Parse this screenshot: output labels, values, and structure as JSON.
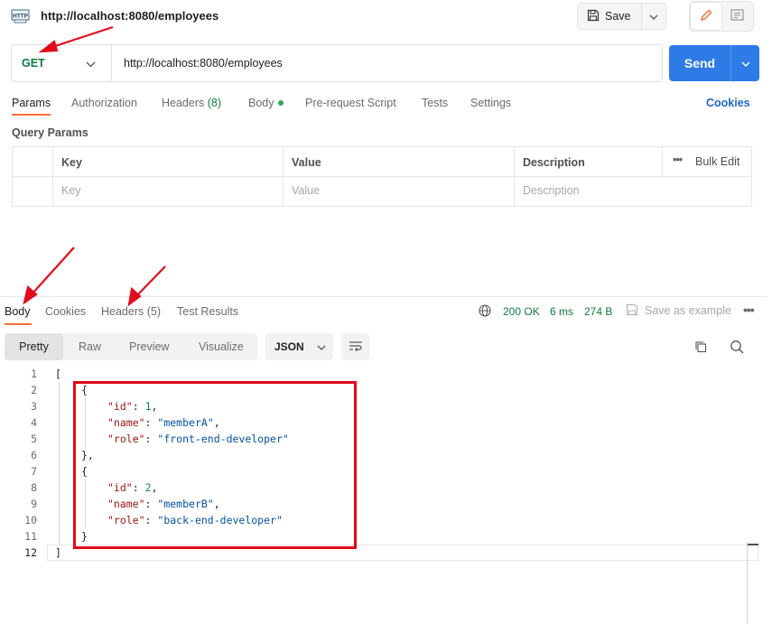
{
  "header": {
    "badge_text": "HTTP",
    "request_title": "http://localhost:8080/employees",
    "save_label": "Save"
  },
  "request": {
    "method": "GET",
    "url": "http://localhost:8080/employees",
    "send_label": "Send"
  },
  "request_tabs": {
    "params": "Params",
    "authorization": "Authorization",
    "headers": "Headers",
    "headers_count": "(8)",
    "body": "Body",
    "prerequest": "Pre-request Script",
    "tests": "Tests",
    "settings": "Settings",
    "cookies": "Cookies"
  },
  "query_params": {
    "title": "Query Params",
    "columns": [
      "Key",
      "Value",
      "Description"
    ],
    "bulk_edit": "Bulk Edit",
    "placeholders": [
      "Key",
      "Value",
      "Description"
    ]
  },
  "response": {
    "tabs": {
      "body": "Body",
      "cookies": "Cookies",
      "headers": "Headers (5)",
      "test_results": "Test Results"
    },
    "status": "200 OK",
    "time": "6 ms",
    "size": "274 B",
    "save_example": "Save as example",
    "view_modes": [
      "Pretty",
      "Raw",
      "Preview",
      "Visualize"
    ],
    "active_view": "Pretty",
    "format": "JSON"
  },
  "code": {
    "line_numbers": [
      "1",
      "2",
      "3",
      "4",
      "5",
      "6",
      "7",
      "8",
      "9",
      "10",
      "11",
      "12"
    ],
    "items": [
      {
        "id_key": "\"id\"",
        "id_val": "1",
        "name_key": "\"name\"",
        "name_val": "\"memberA\"",
        "role_key": "\"role\"",
        "role_val": "\"front-end-developer\""
      },
      {
        "id_key": "\"id\"",
        "id_val": "2",
        "name_key": "\"name\"",
        "name_val": "\"memberB\"",
        "role_key": "\"role\"",
        "role_val": "\"back-end-developer\""
      }
    ],
    "open_bracket": "[",
    "close_bracket": "]",
    "open_brace": "{",
    "close_brace": "}",
    "close_brace_comma": "},"
  },
  "colors": {
    "annotation_red": "#e00b1c",
    "accent_orange": "#ff6c37",
    "send_blue": "#2e7be8",
    "status_green": "#0f7c3d"
  }
}
